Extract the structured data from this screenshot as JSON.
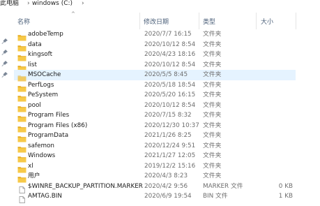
{
  "breadcrumb": {
    "items": [
      "此电脑",
      "windows (C:)"
    ],
    "separator": "›"
  },
  "columns": {
    "name": "名称",
    "date": "修改日期",
    "type": "类型",
    "size": "大小"
  },
  "files": [
    {
      "name": "adobeTemp",
      "date": "2020/7/7 16:15",
      "type": "文件夹",
      "size": "",
      "kind": "folder"
    },
    {
      "name": "data",
      "date": "2020/10/12 8:54",
      "type": "文件夹",
      "size": "",
      "kind": "folder"
    },
    {
      "name": "kingsoft",
      "date": "2020/4/23 18:16",
      "type": "文件夹",
      "size": "",
      "kind": "folder"
    },
    {
      "name": "list",
      "date": "2020/10/12 8:54",
      "type": "文件夹",
      "size": "",
      "kind": "folder"
    },
    {
      "name": "MSOCache",
      "date": "2020/5/5 8:45",
      "type": "文件夹",
      "size": "",
      "kind": "folder-hidden",
      "selected": true
    },
    {
      "name": "PerfLogs",
      "date": "2020/5/18 18:54",
      "type": "文件夹",
      "size": "",
      "kind": "folder"
    },
    {
      "name": "PeSystem",
      "date": "2020/5/20 16:15",
      "type": "文件夹",
      "size": "",
      "kind": "folder"
    },
    {
      "name": "pool",
      "date": "2020/10/12 8:54",
      "type": "文件夹",
      "size": "",
      "kind": "folder"
    },
    {
      "name": "Program Files",
      "date": "2020/7/15 8:32",
      "type": "文件夹",
      "size": "",
      "kind": "folder"
    },
    {
      "name": "Program Files (x86)",
      "date": "2020/12/30 10:37",
      "type": "文件夹",
      "size": "",
      "kind": "folder"
    },
    {
      "name": "ProgramData",
      "date": "2021/1/26 8:25",
      "type": "文件夹",
      "size": "",
      "kind": "folder"
    },
    {
      "name": "safemon",
      "date": "2020/12/24 9:51",
      "type": "文件夹",
      "size": "",
      "kind": "folder"
    },
    {
      "name": "Windows",
      "date": "2021/1/27 12:05",
      "type": "文件夹",
      "size": "",
      "kind": "folder"
    },
    {
      "name": "xl",
      "date": "2019/12/2 15:16",
      "type": "文件夹",
      "size": "",
      "kind": "folder"
    },
    {
      "name": "用户",
      "date": "2020/4/3 8:23",
      "type": "文件夹",
      "size": "",
      "kind": "folder"
    },
    {
      "name": "$WINRE_BACKUP_PARTITION.MARKER",
      "date": "2020/4/2 9:56",
      "type": "MARKER 文件",
      "size": "0 KB",
      "kind": "file"
    },
    {
      "name": "AMTAG.BIN",
      "date": "2020/6/9 19:54",
      "type": "BIN 文件",
      "size": "1 KB",
      "kind": "file"
    }
  ],
  "colors": {
    "folder": "#f7c948",
    "folder_dark": "#e6ac1e",
    "selected_row": "#e5f3ff",
    "header_text": "#4c607a"
  }
}
